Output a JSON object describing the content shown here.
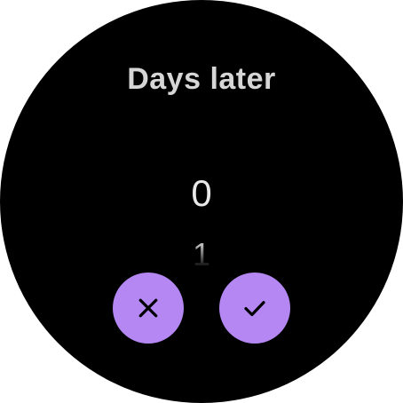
{
  "screen": {
    "title": "Days later"
  },
  "picker": {
    "current_value": "0",
    "next_value": "1"
  },
  "actions": {
    "cancel_icon": "close-icon",
    "confirm_icon": "check-icon"
  },
  "colors": {
    "background": "#000000",
    "button": "#b487f3",
    "icon": "#000000",
    "title": "#d6d6d6",
    "value": "#e8e8e8"
  }
}
